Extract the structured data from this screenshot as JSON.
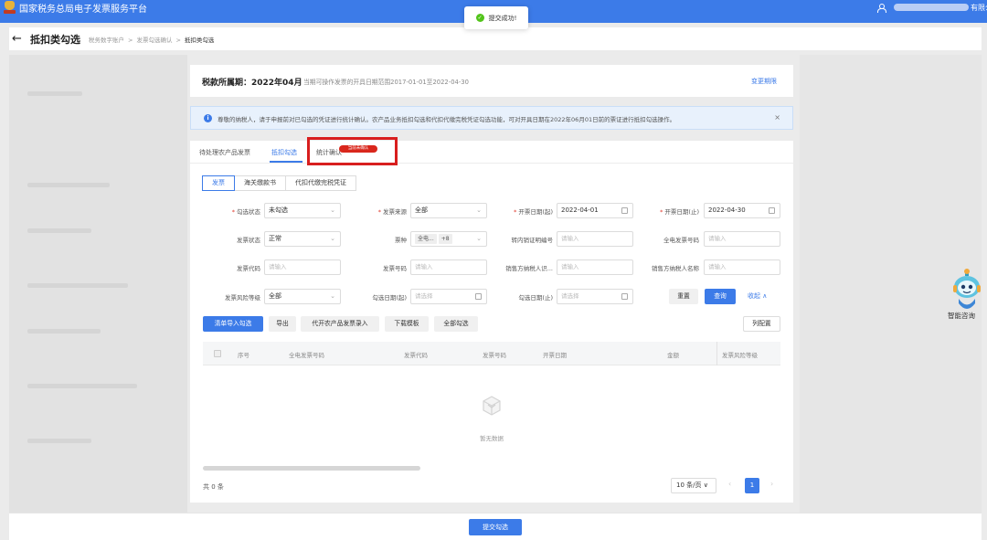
{
  "topbar": {
    "title": "国家税务总局电子发票服务平台",
    "user_suffix": "有限公司"
  },
  "toast": {
    "message": "提交成功!"
  },
  "header": {
    "back_arrow": "←",
    "title": "抵扣类勾选",
    "breadcrumb": [
      "税务数字账户",
      "发票勾选确认",
      "抵扣类勾选"
    ],
    "breadcrumb_sep": ">"
  },
  "period": {
    "label": "税款所属期：2022年04月",
    "range_text": "当期可操作发票的开具日期范围2017-01-01至2022-04-30",
    "change_link": "变更期限"
  },
  "notice": {
    "icon": "i",
    "text": "尊敬的纳税人，请于申报前对已勾选的凭证进行统计确认。农产品业务抵扣勾选和代扣代缴完税凭证勾选功能，可对开具日期在2022年06月01日前的票证进行抵扣勾选操作。",
    "close": "×"
  },
  "tabs": [
    {
      "label": "待处理农产品发票"
    },
    {
      "label": "抵扣勾选"
    },
    {
      "label": "统计确认"
    }
  ],
  "tab_badge": "当前未确认",
  "sub_tabs": [
    {
      "label": "发票"
    },
    {
      "label": "海关缴款书"
    },
    {
      "label": "代扣代缴完税凭证"
    }
  ],
  "filters": {
    "select_status": {
      "label": "勾选状态",
      "value": "未勾选"
    },
    "invoice_source": {
      "label": "发票来源",
      "value": "全部"
    },
    "issue_date_start": {
      "label": "开票日期(起)",
      "value": "2022-04-01"
    },
    "issue_date_end": {
      "label": "开票日期(止)",
      "value": "2022-04-30"
    },
    "invoice_status": {
      "label": "发票状态",
      "value": "正常"
    },
    "ticket_type": {
      "label": "票种",
      "tag1": "全电...",
      "tag2": "+8"
    },
    "transfer_no": {
      "label": "转内销证明编号",
      "placeholder": "请输入"
    },
    "full_invoice_no": {
      "label": "全电发票号码",
      "placeholder": "请输入"
    },
    "invoice_code": {
      "label": "发票代码",
      "placeholder": "请输入"
    },
    "invoice_no": {
      "label": "发票号码",
      "placeholder": "请输入"
    },
    "seller_tax_id": {
      "label": "销售方纳税人识...",
      "placeholder": "请输入"
    },
    "seller_name": {
      "label": "销售方纳税人名称",
      "placeholder": "请输入"
    },
    "risk_level": {
      "label": "发票风险等级",
      "value": "全部"
    },
    "check_date_start": {
      "label": "勾选日期(起)",
      "placeholder": "请选择"
    },
    "check_date_end": {
      "label": "勾选日期(止)",
      "placeholder": "请选择"
    },
    "reset": "重置",
    "query": "查询",
    "collapse": "收起 ∧"
  },
  "toolbar": {
    "buttons": [
      "清单导入勾选",
      "导出",
      "代开农产品发票录入",
      "下载模板",
      "全部勾选"
    ],
    "columns": "列配置"
  },
  "table": {
    "columns": [
      "序号",
      "全电发票号码",
      "发票代码",
      "发票号码",
      "开票日期",
      "金额",
      "发票风险等级"
    ],
    "empty_text": "暂无数据"
  },
  "pagination": {
    "total": "共 0 条",
    "page_size": "10 条/页 ∨",
    "current": "1",
    "prev": "‹",
    "next": "›"
  },
  "footer": {
    "submit": "提交勾选"
  },
  "assistant": {
    "label": "智能咨询"
  },
  "colors": {
    "primary": "#3c7be8",
    "highlight": "#d81e1e",
    "badge": "#d9271c",
    "success": "#52c41a"
  }
}
